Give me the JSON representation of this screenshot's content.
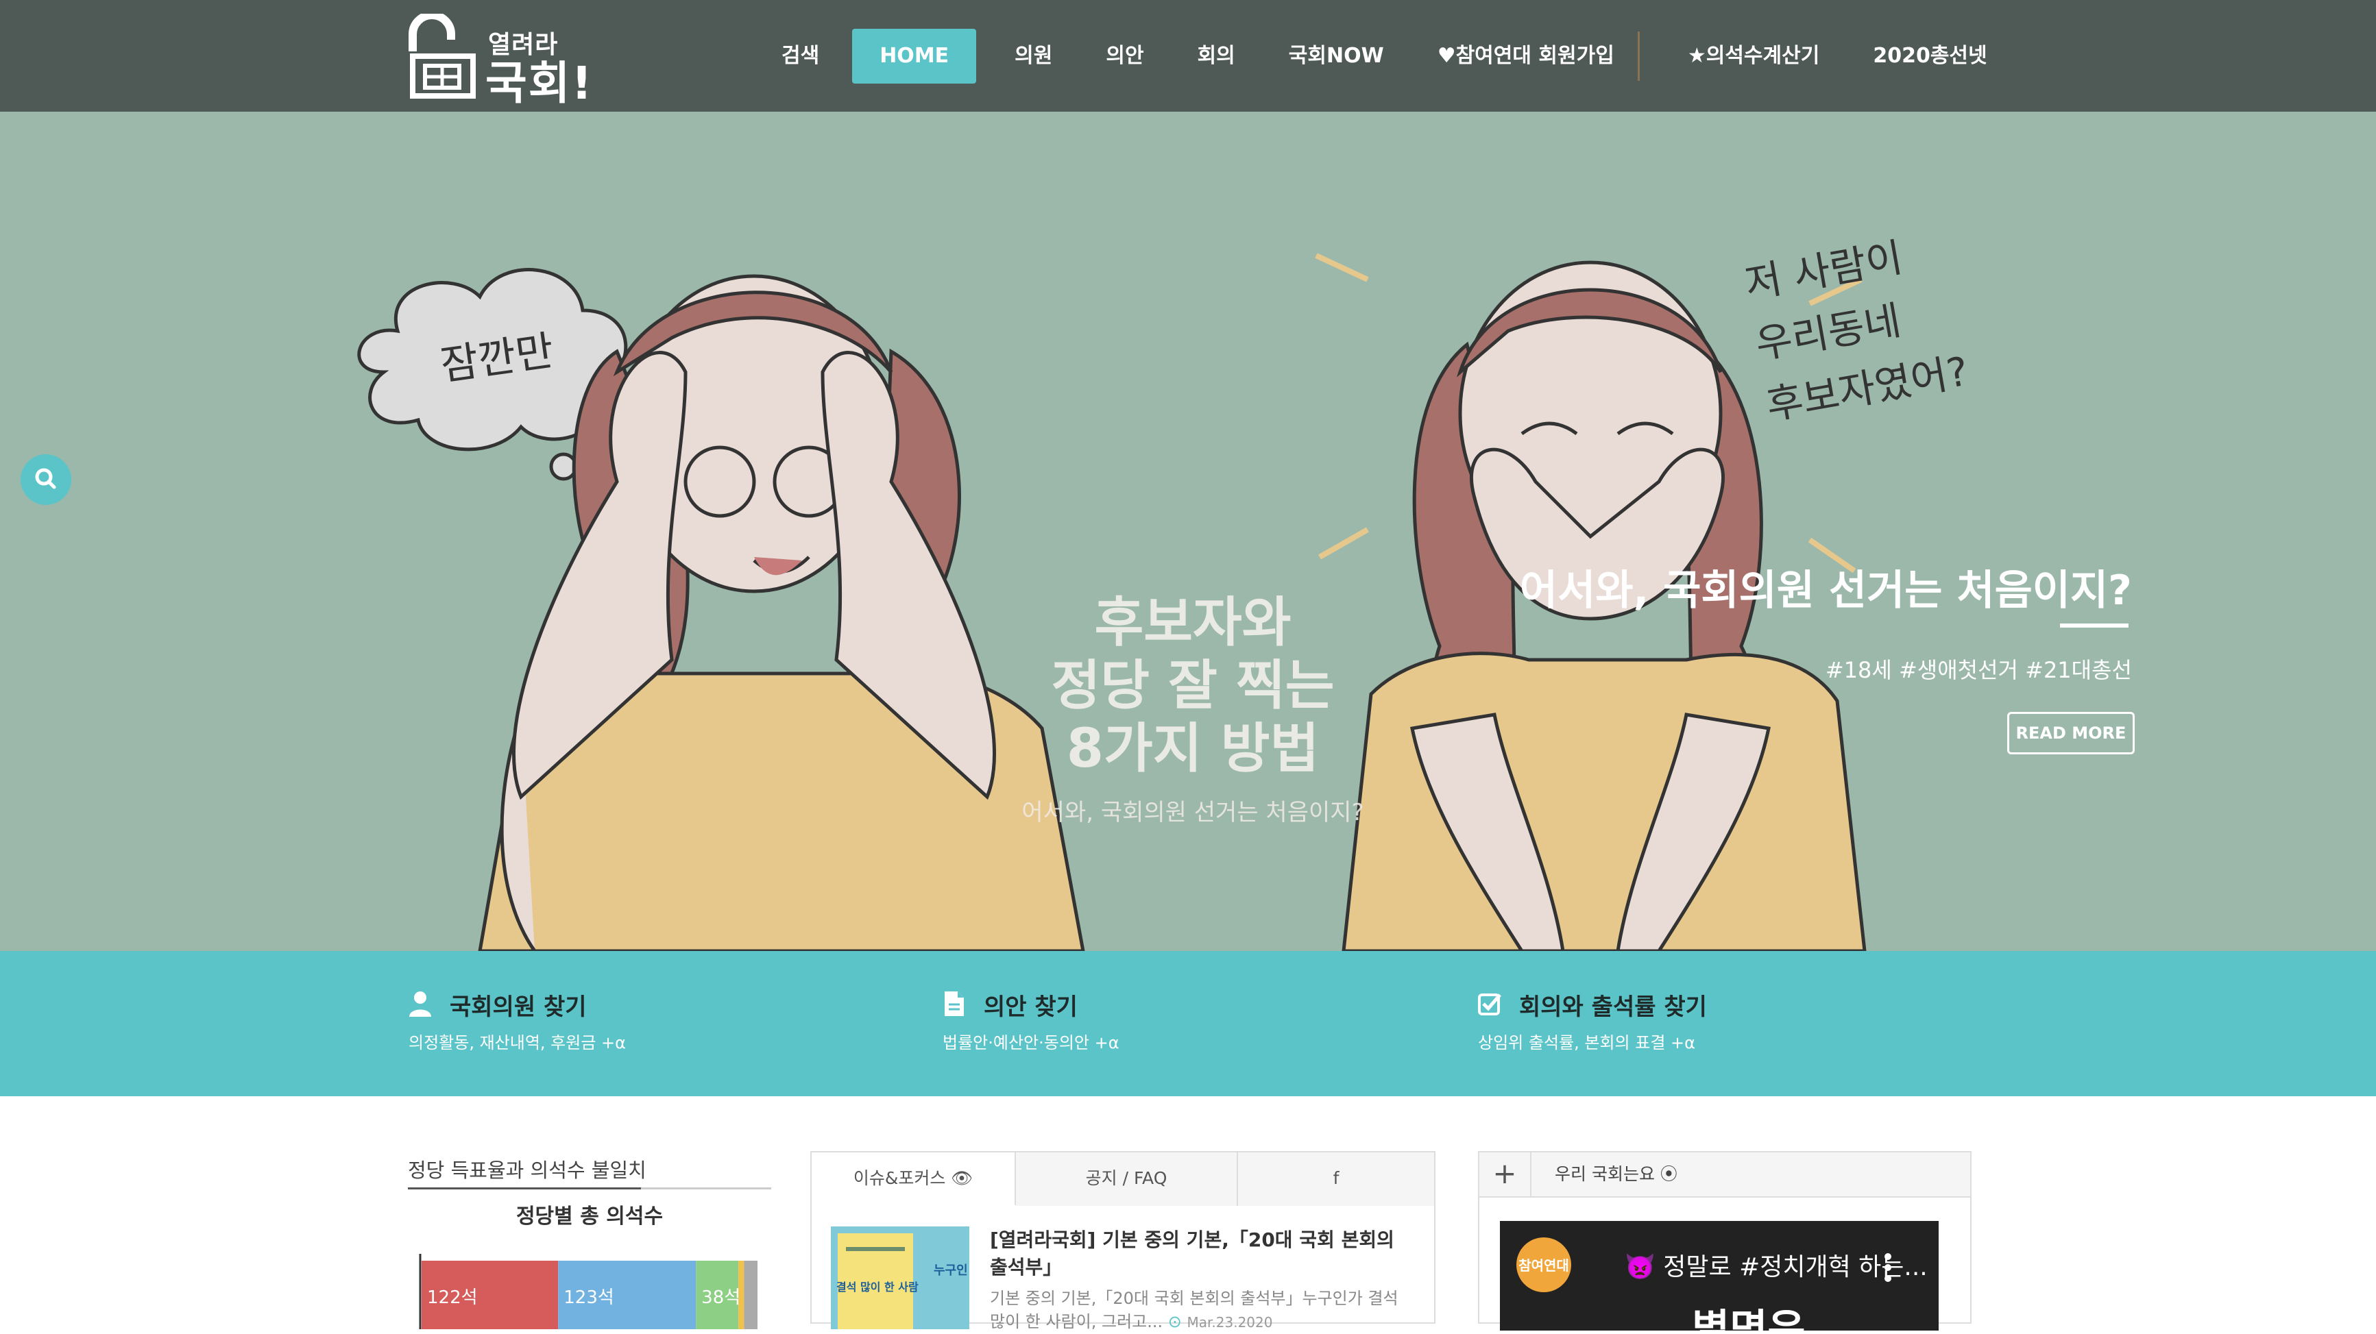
{
  "header": {
    "logo_small": "열려라",
    "logo_big": "국회!",
    "nav": [
      {
        "label": "검색"
      },
      {
        "label": "HOME",
        "active": true
      },
      {
        "label": "의원"
      },
      {
        "label": "의안"
      },
      {
        "label": "회의"
      },
      {
        "label": "국회NOW"
      },
      {
        "label": "♥참여연대 회원가입"
      },
      {
        "label": "★의석수계산기"
      },
      {
        "label": "2020총선넷"
      }
    ]
  },
  "hero": {
    "bubble_text": "잠깐만",
    "side_text": [
      "저 사람이",
      "우리동네",
      "후보자였어?"
    ],
    "center_title": [
      "후보자와",
      "정당 잘 찍는",
      "8가지 방법"
    ],
    "center_sub": "어서와, 국회의원 선거는 처음이지?",
    "slide_title": "어서와, 국회의원 선거는 처음이지?",
    "slide_tags": "#18세 #생애첫선거 #21대총선",
    "read_more": "READ MORE",
    "colors": {
      "background": "#9bb8aa",
      "hair": "#a8706a",
      "skin": "#e9dcd6",
      "shirt": "#e6c88d"
    }
  },
  "features": [
    {
      "icon": "user-icon",
      "title": "국회의원 찾기",
      "desc": "의정활동, 재산내역, 후원금 +α"
    },
    {
      "icon": "document-icon",
      "title": "의안 찾기",
      "desc": "법률안·예산안·동의안 +α"
    },
    {
      "icon": "checkbox-icon",
      "title": "회의와 출석률 찾기",
      "desc": "상임위 출석률, 본회의 표결 +α"
    }
  ],
  "widget_left": {
    "title": "정당 득표율과 의석수 불일치",
    "chart_title": "정당별 총 의석수"
  },
  "chart_data": {
    "type": "bar",
    "title": "정당별 총 의석수",
    "orientation": "horizontal-stacked",
    "series": [
      {
        "value": 122,
        "label": "122석",
        "color": "#d65c5c"
      },
      {
        "value": 123,
        "label": "123석",
        "color": "#72b2e0"
      },
      {
        "value": 38,
        "label": "38석",
        "color": "#8ecf86"
      },
      {
        "value": 5,
        "label": "",
        "color": "#f0c14b"
      },
      {
        "value": 12,
        "label": "",
        "color": "#aaaaaa"
      }
    ]
  },
  "widget_mid": {
    "tabs": [
      "이슈&포커스 👁",
      "공지 / FAQ",
      "f"
    ],
    "post": {
      "title": "[열려라국회] 기본 중의 기본,「20대 국회 본회의 출석부」",
      "excerpt": "기본 중의 기본,「20대 국회 본회의 출석부」누구인가 결석 많이 한 사람이, 그러고...",
      "date": "Mar.23.2020",
      "thumb_text": [
        "누구인",
        "결석 많이 한 사람"
      ]
    }
  },
  "widget_right": {
    "plus": "+",
    "title": "우리 국회는요 ⦿",
    "video": {
      "channel": "참여연대",
      "title": "👿 정말로 #정치개혁 하는...",
      "overlay": "별명은"
    }
  }
}
